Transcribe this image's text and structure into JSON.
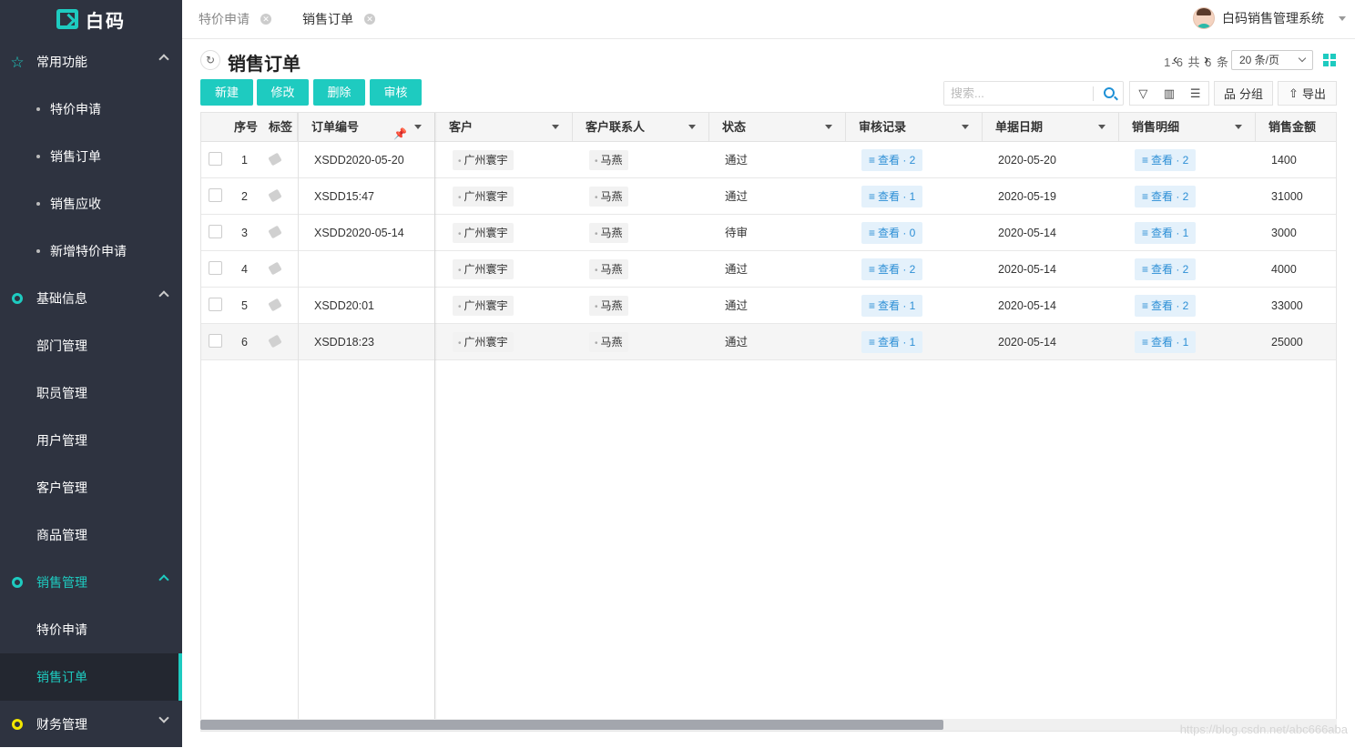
{
  "app": {
    "logo_text": "白码",
    "system_name": "白码销售管理系统"
  },
  "sidebar": {
    "groups": [
      {
        "label": "常用功能",
        "icon": "star-icon"
      },
      {
        "label": "基础信息",
        "icon": "ring-icon"
      },
      {
        "label": "销售管理",
        "icon": "ring-icon"
      },
      {
        "label": "财务管理",
        "icon": "ring-icon"
      }
    ],
    "common": [
      "特价申请",
      "销售订单",
      "销售应收",
      "新增特价申请"
    ],
    "basic": [
      "部门管理",
      "职员管理",
      "用户管理",
      "客户管理",
      "商品管理"
    ],
    "sales": [
      "特价申请",
      "销售订单"
    ]
  },
  "tabs": [
    {
      "label": "特价申请"
    },
    {
      "label": "销售订单"
    }
  ],
  "page": {
    "title": "销售订单",
    "pager": "1-6 共 6 条",
    "page_size": "20 条/页"
  },
  "toolbar": {
    "new": "新建",
    "edit": "修改",
    "delete": "删除",
    "review": "审核",
    "search_placeholder": "搜索...",
    "group": "分组",
    "export": "导出"
  },
  "table": {
    "columns": [
      "序号",
      "标签",
      "订单编号",
      "客户",
      "客户联系人",
      "状态",
      "审核记录",
      "单据日期",
      "销售明细",
      "销售金额"
    ],
    "rows": [
      {
        "no": "1",
        "order": "XSDD2020-05-20",
        "customer": "广州寰宇",
        "contact": "马燕",
        "status": "通过",
        "review": "查看 · 2",
        "date": "2020-05-20",
        "detail": "查看 · 2",
        "amount": "1400"
      },
      {
        "no": "2",
        "order": "XSDD15:47",
        "customer": "广州寰宇",
        "contact": "马燕",
        "status": "通过",
        "review": "查看 · 1",
        "date": "2020-05-19",
        "detail": "查看 · 2",
        "amount": "31000"
      },
      {
        "no": "3",
        "order": "XSDD2020-05-14",
        "customer": "广州寰宇",
        "contact": "马燕",
        "status": "待审",
        "review": "查看 · 0",
        "date": "2020-05-14",
        "detail": "查看 · 1",
        "amount": "3000"
      },
      {
        "no": "4",
        "order": "",
        "customer": "广州寰宇",
        "contact": "马燕",
        "status": "通过",
        "review": "查看 · 2",
        "date": "2020-05-14",
        "detail": "查看 · 2",
        "amount": "4000"
      },
      {
        "no": "5",
        "order": "XSDD20:01",
        "customer": "广州寰宇",
        "contact": "马燕",
        "status": "通过",
        "review": "查看 · 1",
        "date": "2020-05-14",
        "detail": "查看 · 2",
        "amount": "33000"
      },
      {
        "no": "6",
        "order": "XSDD18:23",
        "customer": "广州寰宇",
        "contact": "马燕",
        "status": "通过",
        "review": "查看 · 1",
        "date": "2020-05-14",
        "detail": "查看 · 1",
        "amount": "25000"
      }
    ]
  },
  "watermark": "https://blog.csdn.net/abc666aba",
  "colors": {
    "accent": "#1ecbc0",
    "sidebar_bg": "#2e3340",
    "link": "#2d8fd6"
  }
}
